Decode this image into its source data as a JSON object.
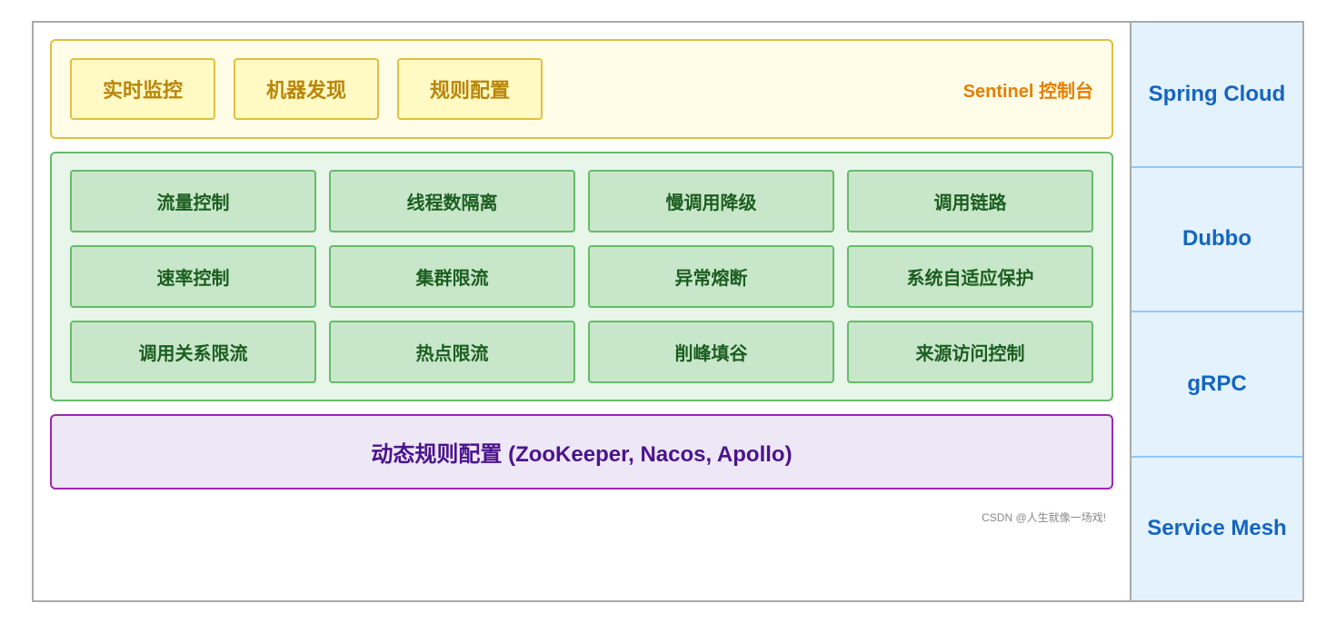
{
  "sentinel": {
    "box1": "实时监控",
    "box2": "机器发现",
    "box3": "规则配置",
    "label": "Sentinel 控制台"
  },
  "features": {
    "row1": [
      "流量控制",
      "线程数隔离",
      "慢调用降级",
      "调用链路"
    ],
    "row2": [
      "速率控制",
      "集群限流",
      "异常熔断",
      "系统自适应保护"
    ],
    "row3": [
      "调用关系限流",
      "热点限流",
      "削峰填谷",
      "来源访问控制"
    ]
  },
  "dynamic": {
    "text": "动态规则配置 (ZooKeeper, Nacos, Apollo)"
  },
  "sidebar": {
    "items": [
      {
        "label": "Spring Cloud"
      },
      {
        "label": "Dubbo"
      },
      {
        "label": "gRPC"
      },
      {
        "label": "Service Mesh"
      }
    ]
  },
  "footer": {
    "text": "CSDN @人生就像一场戏!"
  }
}
